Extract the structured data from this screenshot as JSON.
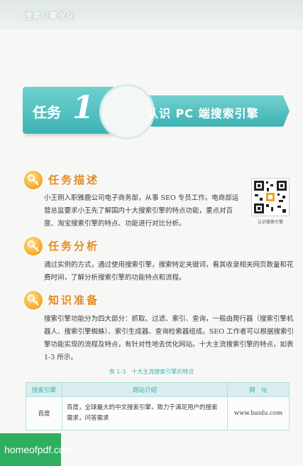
{
  "header": {
    "title": "搜索引擎优化"
  },
  "task": {
    "word": "任务",
    "number": "1",
    "title": "认识 PC 端搜索引擎"
  },
  "sections": [
    {
      "title": "任务描述",
      "body": "小王刚入职雅鹿公司电子商务部，从事 SEO 专员工作。电商部运营总监要求小王先了解国内十大搜索引擎的特点功能，重点对百度、淘宝搜索引擎的特点、功能进行对比分析。"
    },
    {
      "title": "任务分析",
      "body": "通过实例的方式，通过使用搜索引擎，搜索特定关键词，看其收录相关网页数量和花费时间，了解分析搜索引擎的功能特点和流程。"
    },
    {
      "title": "知识准备",
      "body": "搜索引擎功能分为四大部分：抓取、过滤、索引、查询，一般由爬行器（搜索引擎机器人、搜索引擎蜘蛛）、索引生成器、查询检索器组成。SEO 工作者可以根据搜索引擎功能实现的流程及特点，有针对性地去优化网站。十大主流搜索引擎的特点，如表 1-3 所示。"
    }
  ],
  "qr": {
    "caption": "认识搜索引擎"
  },
  "table": {
    "caption": "表 1-3　十大主流搜索引擎的特点",
    "headers": [
      "搜索引擎",
      "网站介绍",
      "网　址"
    ],
    "rows": [
      {
        "name": "百度",
        "desc": "百度，全球最大的中文搜索引擎，致力于满足用户的搜索需求，问答需求",
        "url": "www.baidu.com"
      }
    ]
  },
  "watermark": {
    "text": "homeofpdf.com"
  },
  "colors": {
    "accent": "#3fb0b1",
    "section": "#e58a1f",
    "watermark": "#2fae5f"
  }
}
